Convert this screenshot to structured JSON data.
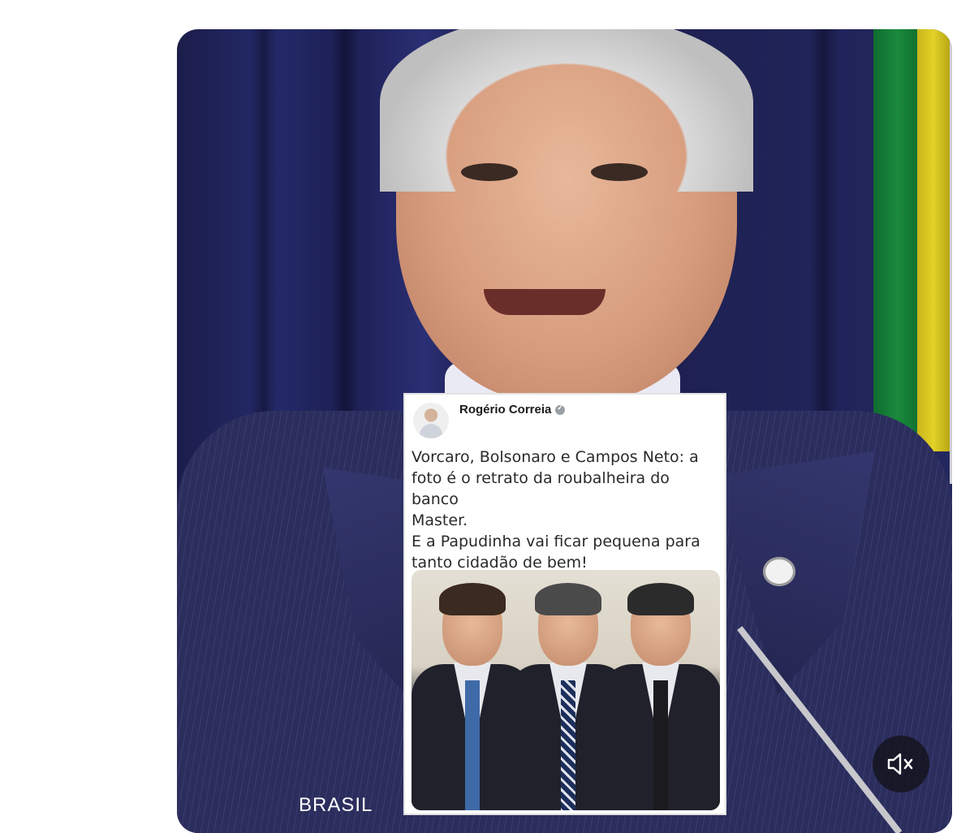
{
  "media": {
    "watermark": "BRASIL",
    "mute_icon": "speaker-muted-icon"
  },
  "tweet": {
    "author": "Rogério Correia",
    "verified_icon": "verified-badge-icon",
    "text": "Vorcaro, Bolsonaro e Campos Neto: a\nfoto é o retrato da roubalheira do banco\nMaster.\nE a Papudinha vai ficar pequena para\ntanto cidadão de bem!"
  }
}
